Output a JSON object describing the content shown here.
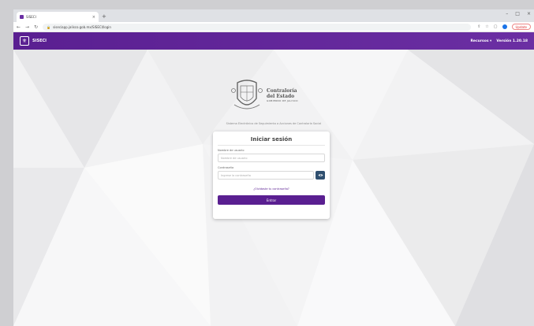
{
  "browser": {
    "tab_title": "SISECI",
    "tab_close": "×",
    "new_tab": "+",
    "url": "siseciapp.jalisco.gob.mx/SISECI/login",
    "nav": {
      "back": "←",
      "forward": "→",
      "reload": "↻"
    },
    "window_controls": {
      "minimize": "–",
      "maximize": "□",
      "close": "×"
    },
    "update_label": "Update"
  },
  "app": {
    "name": "SISECI",
    "menu_label": "Recursos ▾",
    "version": "Versión 1.20.18"
  },
  "brand": {
    "line1": "Contraloría",
    "line2": "del Estado",
    "line3": "GOBIERNO DE JALISCO"
  },
  "system_name": "Sistema Electrónico de Seguimiento a Acciones de Contraloría Social",
  "login": {
    "title": "Iniciar sesión",
    "user_label": "Nombre de usuario",
    "user_placeholder": "Nombre de usuario",
    "password_label": "Contraseña",
    "password_placeholder": "Ingrese la contraseña",
    "forgot_label": "¿Olvidaste tu contraseña?",
    "submit_label": "Entrar"
  },
  "colors": {
    "brand_purple": "#5a1f91",
    "eye_button": "#2f4f6f"
  }
}
